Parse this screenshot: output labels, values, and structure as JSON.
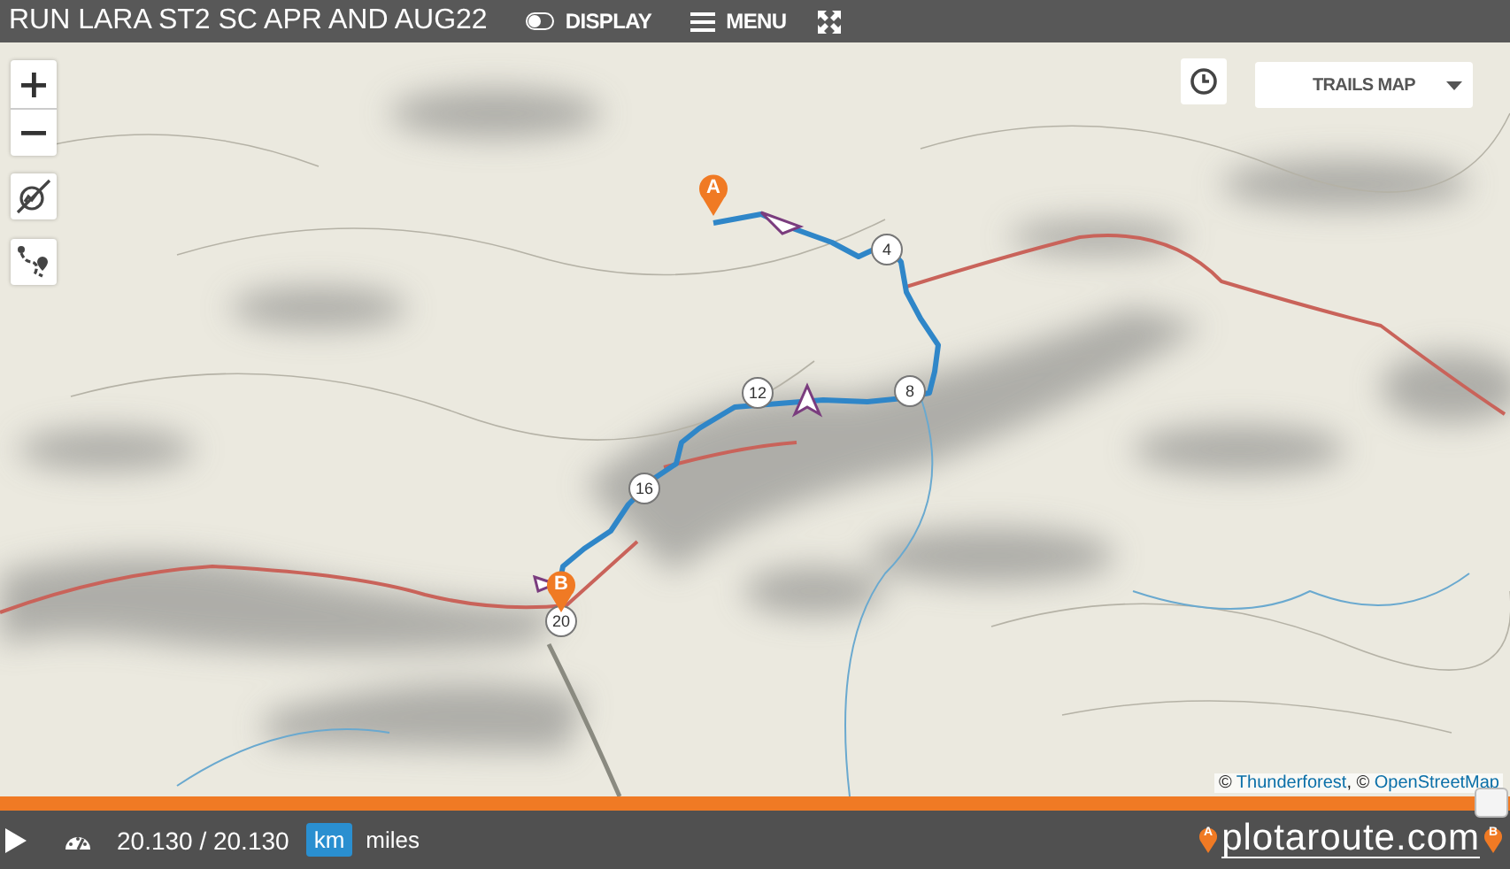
{
  "header": {
    "title": "RUN LARA ST2 SC APR AND AUG22",
    "display": {
      "label": "DISPLAY",
      "on": false
    },
    "menu": {
      "label": "MENU"
    }
  },
  "map": {
    "layer_select": {
      "label": "TRAILS MAP"
    },
    "distance_markers": [
      {
        "label": "4"
      },
      {
        "label": "8"
      },
      {
        "label": "12"
      },
      {
        "label": "16"
      },
      {
        "label": "20"
      }
    ],
    "pins": [
      {
        "label": "A",
        "kind": "start"
      },
      {
        "label": "B",
        "kind": "end"
      }
    ],
    "attribution": [
      {
        "kind": "text",
        "text": "© "
      },
      {
        "kind": "link",
        "text": "Thunderforest"
      },
      {
        "kind": "text",
        "text": ", © "
      },
      {
        "kind": "link",
        "text": "OpenStreetMap"
      }
    ]
  },
  "progress": {
    "level": 1
  },
  "player": {
    "distance": "20.130 / 20.130",
    "units": [
      {
        "label": "km",
        "selected": true
      },
      {
        "label": "miles",
        "selected": false
      }
    ]
  },
  "logo": {
    "text": "plotaroute.com",
    "pins": [
      "A",
      "B"
    ]
  }
}
